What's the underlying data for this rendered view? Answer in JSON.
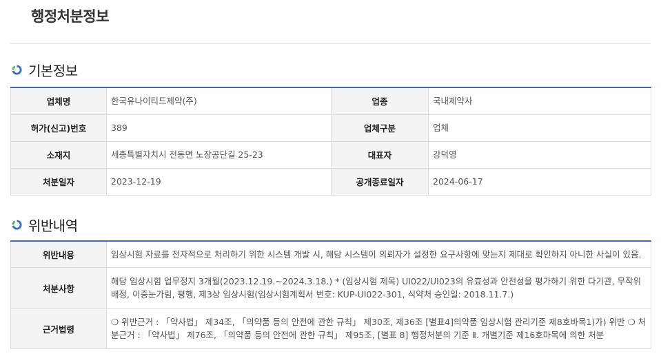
{
  "page": {
    "title": "행정처분정보"
  },
  "basic": {
    "section_title": "기본정보",
    "rows": [
      {
        "l1": "업체명",
        "v1": "한국유나이티드제약(주)",
        "l2": "업종",
        "v2": "국내제약사"
      },
      {
        "l1": "허가(신고)번호",
        "v1": "389",
        "l2": "업체구분",
        "v2": "업체"
      },
      {
        "l1": "소재지",
        "v1": "세종특별자치시 전동면 노장공단길 25-23",
        "l2": "대표자",
        "v2": "강덕영"
      },
      {
        "l1": "처분일자",
        "v1": "2023-12-19",
        "l2": "공개종료일자",
        "v2": "2024-06-17"
      }
    ]
  },
  "violation": {
    "section_title": "위반내역",
    "rows": [
      {
        "label": "위반내용",
        "value": "임상시험 자료를 전자적으로 처리하기 위한 시스템 개발 시, 해당 시스템이 의뢰자가 설정한 요구사항에 맞는지 제대로 확인하지 아니한 사실이 있음."
      },
      {
        "label": "처분사항",
        "value": "해당 임상시험 업무정지 3개월(2023.12.19.~2024.3.18.) * (임상시험 제목) UI022/UI023의 유효성과 안전성을 평가하기 위한 다기관, 무작위 배정, 이중눈가림, 평행, 제3상 임상시험(임상시험계획서 번호: KUP-UI022-301, 식약처 승인일: 2018.11.7.)"
      },
      {
        "label": "근거법령",
        "value": "❍ 위반근거 : 「약사법」 제34조, 「의약품 등의 안전에 관한 규칙」 제30조, 제36조 [별표4]의약품 임상시험 관리기준 제8호바목1)가) 위반 ❍ 처분근거 : 「약사법」 제76조, 「의약품 등의 안전에 관한 규칙」 제95조, [별표 8] 행정처분의 기준 Ⅱ. 개별기준 제16호마목에 의한 처분"
      }
    ]
  },
  "colors": {
    "accent": "#3c6db3",
    "icon_green": "#55b36b",
    "header_bg": "#f4f4f4"
  },
  "icons": {
    "section": "circle-arrow-icon"
  }
}
